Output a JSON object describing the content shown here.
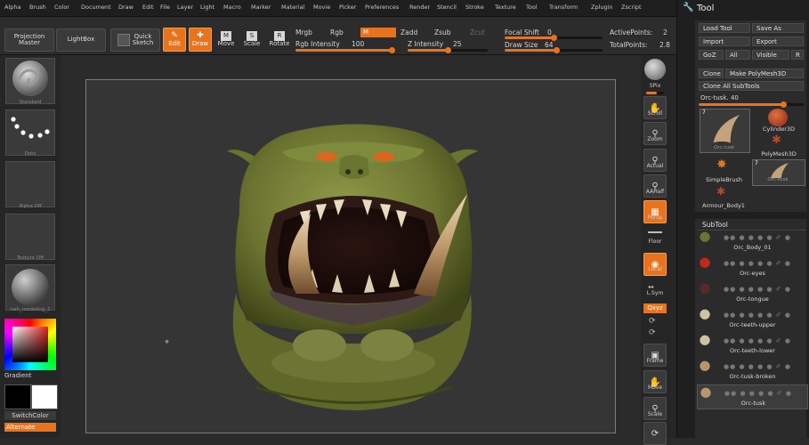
{
  "menu": [
    "Alpha",
    "Brush",
    "Color",
    "Document",
    "Draw",
    "Edit",
    "File",
    "Layer",
    "Light",
    "Macro",
    "Marker",
    "Material",
    "Movie",
    "Picker",
    "Preferences",
    "Render",
    "Stencil",
    "Stroke",
    "Texture",
    "Tool",
    "Transform",
    "Zplugin",
    "Zscript"
  ],
  "toolbar": {
    "projection_master": [
      "Projection",
      "Master"
    ],
    "lightbox": "LightBox",
    "quick_sketch": [
      "Quick",
      "Sketch"
    ],
    "edit": "Edit",
    "draw": "Draw",
    "move": "Move",
    "scale": "Scale",
    "rotate": "Rotate",
    "mrgb": "Mrgb",
    "rgb": "Rgb",
    "m": "M",
    "zadd": "Zadd",
    "zsub": "Zsub",
    "zcut": "Zcut",
    "rgb_intensity_label": "Rgb Intensity",
    "rgb_intensity": "100",
    "z_intensity_label": "Z Intensity",
    "z_intensity": "25",
    "focal_shift_label": "Focal Shift",
    "focal_shift": "0",
    "draw_size_label": "Draw Size",
    "draw_size": "64",
    "active_points_label": "ActivePoints:",
    "active_points": "2",
    "total_points_label": "TotalPoints:",
    "total_points": "2.8"
  },
  "left_shelf": {
    "brush_label": "Standard",
    "stroke_label": "Dots",
    "alpha_label": "Alpha Off",
    "texture_label": "Texture Off",
    "material_label": "nah_modeling_2",
    "gradient_label": "Gradient",
    "switch_color_label": "SwitchColor",
    "alternate_label": "Alternate"
  },
  "nav": {
    "spix": "SPix",
    "scroll": "Scroll",
    "zoom": "Zoom",
    "actual": "Actual",
    "aahalf": "AAHalf",
    "persp": "Persp",
    "floor": "Floor",
    "local": "Local",
    "lsym": "L.Sym",
    "xyz": "Qxyz",
    "frame": "Frame",
    "move": "Move",
    "scale": "Scale"
  },
  "tool_panel": {
    "title": "Tool",
    "load_tool": "Load Tool",
    "save_as": "Save As",
    "import": "Import",
    "export": "Export",
    "goz": "GoZ",
    "all": "All",
    "visible": "Visible",
    "r": "R",
    "clone": "Clone",
    "make_polymesh": "Make PolyMesh3D",
    "clone_all": "Clone All SubTools",
    "current_tool_label": "Orc-tusk.",
    "current_tool_value": "40",
    "thumb_badge": "7",
    "thumbs": [
      "Orc-tusk",
      "Cylinder3D",
      "PolyMesh3D",
      "SimpleBrush",
      "Orc-tusk",
      "Armour_Body1"
    ],
    "subtool_header": "SubTool",
    "subtools": [
      "Orc_Body_01",
      "Orc-eyes",
      "Orc-tongue",
      "Orc-teeth-upper",
      "Orc-teeth-lower",
      "Orc-tusk-broken",
      "Orc-tusk"
    ]
  },
  "colors": {
    "accent": "#e8731d",
    "primary_swatch": "#000000",
    "secondary_swatch": "#ffffff",
    "skin": "#6f7a34"
  }
}
